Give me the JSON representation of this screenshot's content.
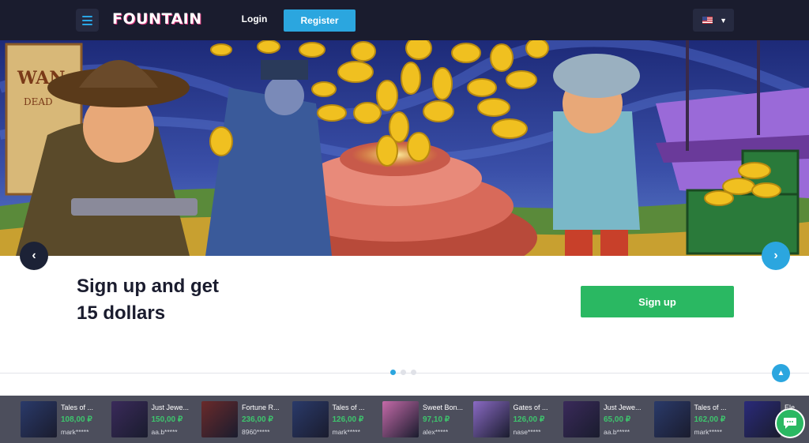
{
  "header": {
    "logo": "FOUNTAIN",
    "login_label": "Login",
    "register_label": "Register",
    "language_icon": "us-flag-icon"
  },
  "banner": {
    "slide_count": 3,
    "active_slide": 1
  },
  "promo": {
    "title_line1": "Sign up and get",
    "title_line2": "15 dollars",
    "signup_label": "Sign up"
  },
  "colors": {
    "header_bg": "#1a1c2e",
    "accent_blue": "#2ba6df",
    "accent_green": "#2ab862",
    "win_green": "#3ec46d"
  },
  "winners": [
    {
      "game": "Tales of ...",
      "amount": "108,00 ₽",
      "user": "mark*****",
      "thumb": "#2a3a6a"
    },
    {
      "game": "Just Jewe...",
      "amount": "150,00 ₽",
      "user": "aa.b*****",
      "thumb": "#3a2a5a"
    },
    {
      "game": "Fortune R...",
      "amount": "236,00 ₽",
      "user": "8960*****",
      "thumb": "#6a2a2a"
    },
    {
      "game": "Tales of ...",
      "amount": "126,00 ₽",
      "user": "mark*****",
      "thumb": "#2a3a6a"
    },
    {
      "game": "Sweet Bon...",
      "amount": "97,10 ₽",
      "user": "alex*****",
      "thumb": "#c46aa8"
    },
    {
      "game": "Gates of ...",
      "amount": "126,00 ₽",
      "user": "nase*****",
      "thumb": "#8a6ac4"
    },
    {
      "game": "Just Jewe...",
      "amount": "65,00 ₽",
      "user": "aa.b*****",
      "thumb": "#3a2a5a"
    },
    {
      "game": "Tales of ...",
      "amount": "162,00 ₽",
      "user": "mark*****",
      "thumb": "#2a3a6a"
    },
    {
      "game": "Ele",
      "amount": "",
      "user": "",
      "thumb": "#2a2a7a"
    }
  ]
}
